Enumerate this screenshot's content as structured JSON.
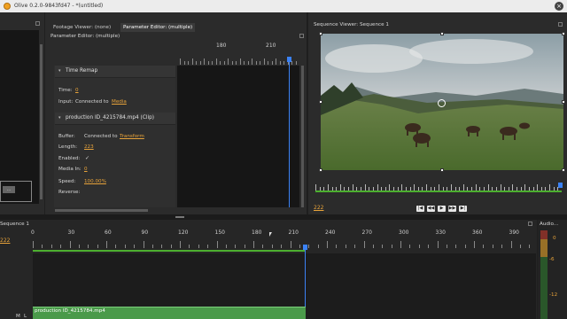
{
  "window": {
    "title": "Olive 0.2.0-9843fd47 - *(untitled)",
    "close_glyph": "×"
  },
  "left_panel": {
    "small_button_label": "..."
  },
  "param_panel": {
    "tabs": [
      "Footage Viewer: (none)",
      "Parameter Editor: (multiple)"
    ],
    "title": "Parameter Editor: (multiple)",
    "ruler_labels": [
      "180",
      "210"
    ],
    "time_remap": {
      "header": "Time Remap",
      "time_label": "Time:",
      "time_value": "0",
      "input_label": "Input:",
      "input_text": "Connected to",
      "input_link": "Media"
    },
    "clip_section": {
      "header": "production ID_4215784.mp4 (Clip)",
      "buffer_label": "Buffer:",
      "buffer_text": "Connected to",
      "buffer_link": "Transform",
      "length_label": "Length:",
      "length_value": "223",
      "enabled_label": "Enabled:",
      "enabled_value": "✓",
      "media_in_label": "Media In:",
      "media_in_value": "0",
      "speed_label": "Speed:",
      "speed_value": "100.00%",
      "reverse_label": "Reverse:"
    }
  },
  "viewer": {
    "title": "Sequence Viewer: Sequence 1",
    "current_frame": "222",
    "transport": [
      "|◀",
      "◀◀",
      "▶",
      "▶▶",
      "▶|"
    ]
  },
  "timeline": {
    "title": "Sequence 1",
    "current_frame": "222",
    "ruler_labels": [
      "0",
      "30",
      "60",
      "90",
      "120",
      "150",
      "180",
      "210",
      "240",
      "270",
      "300",
      "330",
      "360",
      "390"
    ],
    "track_labels": [
      "M",
      "L"
    ],
    "clip_name": "production ID_4215784.mp4"
  },
  "audio_meter": {
    "title": "Audio...",
    "scale": [
      "0",
      "-6",
      "-12"
    ]
  },
  "colors": {
    "accent": "#e8a33a",
    "playhead": "#3b82f6",
    "clip": "#4a9a4a",
    "ruler_green": "#4caf2f"
  }
}
